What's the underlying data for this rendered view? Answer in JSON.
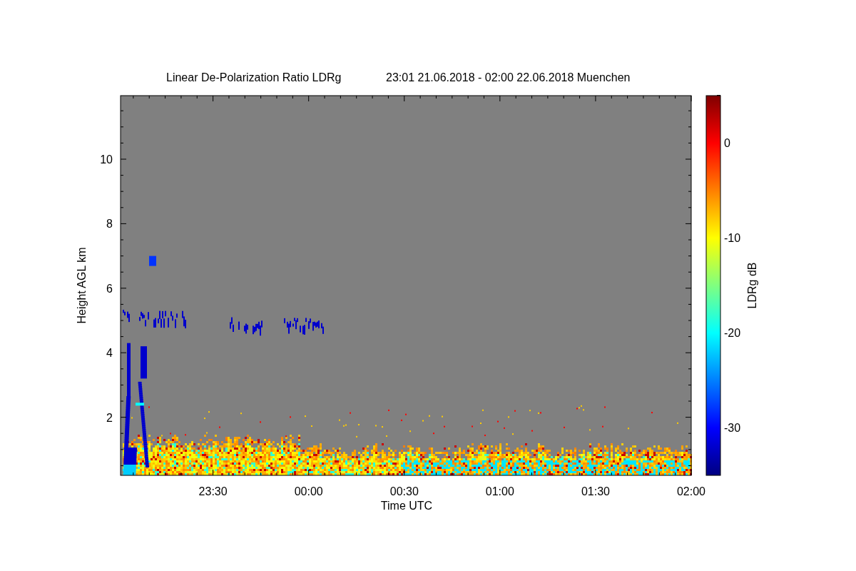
{
  "title": {
    "name": "Linear De-Polarization Ratio LDRg",
    "period": "23:01 21.06.2018 - 02:00 22.06.2018 Muenchen"
  },
  "plot": {
    "ylabel": "Height AGL km",
    "xlabel": "Time UTC",
    "yticks": [
      "10",
      "8",
      "6",
      "4",
      "2"
    ],
    "xticks": [
      "23:30",
      "00:00",
      "00:30",
      "01:00",
      "01:30",
      "02:00"
    ]
  },
  "colorbar": {
    "label": "LDRg dB",
    "ticks": [
      "0",
      "-10",
      "-20",
      "-30"
    ]
  }
}
